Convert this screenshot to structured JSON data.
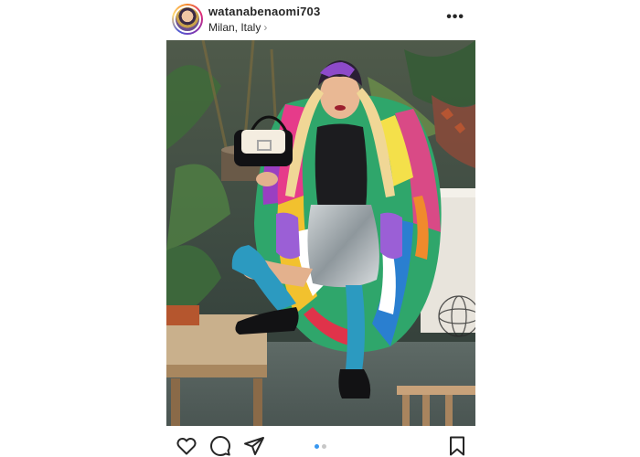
{
  "post": {
    "username": "watanabenaomi703",
    "location": "Milan, Italy",
    "location_chevron": "›",
    "more_label": "•••",
    "photo": {
      "alt": "Woman in a multicolor fur coat holding a handbag, posing among plants"
    },
    "actions": {
      "like_icon": "heart-icon",
      "comment_icon": "comment-icon",
      "share_icon": "share-icon",
      "save_icon": "bookmark-icon"
    },
    "carousel": {
      "current": 1,
      "total": 2
    }
  },
  "colors": {
    "text": "#262626",
    "secondary": "#8e8e8e",
    "accent": "#3897f0",
    "inactive_dot": "#c7c7c7"
  }
}
